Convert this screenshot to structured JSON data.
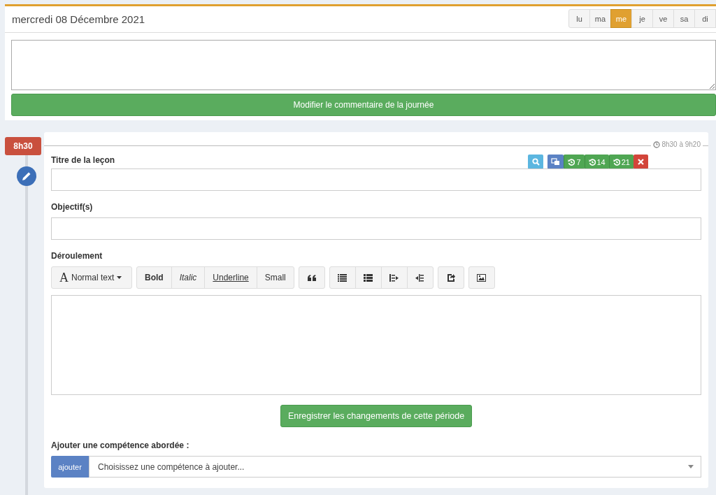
{
  "day_header": {
    "title": "mercredi 08 Décembre 2021",
    "days": [
      {
        "label": "lu",
        "selected": false
      },
      {
        "label": "ma",
        "selected": false
      },
      {
        "label": "me",
        "selected": true
      },
      {
        "label": "je",
        "selected": false
      },
      {
        "label": "ve",
        "selected": false
      },
      {
        "label": "sa",
        "selected": false
      },
      {
        "label": "di",
        "selected": false
      }
    ]
  },
  "day_comment": {
    "button": "Modifier le commentaire de la journée"
  },
  "lesson": {
    "time_badge": "8h30",
    "time_range": "8h30 à 9h20",
    "actions": [
      {
        "kind": "search"
      },
      {
        "kind": "copy"
      },
      {
        "kind": "history",
        "label": "7"
      },
      {
        "kind": "history",
        "label": "14"
      },
      {
        "kind": "history",
        "label": "21"
      },
      {
        "kind": "delete"
      }
    ],
    "title_label": "Titre de la leçon",
    "objectives_label": "Objectif(s)",
    "progress_label": "Déroulement",
    "toolbar": {
      "style_dropdown": "Normal text",
      "format_buttons": [
        {
          "kind": "bold",
          "label": "Bold"
        },
        {
          "kind": "italic",
          "label": "Italic"
        },
        {
          "kind": "underline",
          "label": "Underline"
        },
        {
          "kind": "small",
          "label": "Small"
        }
      ],
      "style_glyph": "A",
      "icon_groups": [
        [
          {
            "kind": "quote"
          }
        ],
        [
          {
            "kind": "bullet-list"
          },
          {
            "kind": "numbered-list"
          },
          {
            "kind": "outdent"
          },
          {
            "kind": "indent"
          }
        ],
        [
          {
            "kind": "link"
          }
        ],
        [
          {
            "kind": "image"
          }
        ]
      ]
    },
    "save_button": "Enregistrer les changements de cette période",
    "competence_label": "Ajouter une compétence abordée :",
    "add_button": "ajouter",
    "competence_select": {
      "placeholder": "Choisissez une compétence à ajouter..."
    }
  }
}
